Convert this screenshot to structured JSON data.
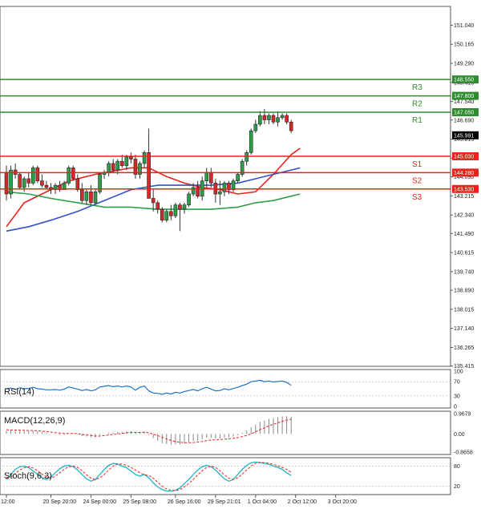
{
  "chart_data": {
    "type": "candlestick",
    "y_axis": {
      "range": [
        135.4,
        151.9
      ],
      "ticks": [
        "151.040",
        "150.165",
        "149.290",
        "148.415",
        "147.540",
        "146.690",
        "145.815",
        "144.940",
        "144.090",
        "143.215",
        "142.340",
        "141.490",
        "140.615",
        "139.740",
        "138.890",
        "138.015",
        "137.140",
        "136.265",
        "135.415"
      ]
    },
    "x_ticks": [
      {
        "label": "12:00",
        "index": 0
      },
      {
        "label": "20 Sep 20:00",
        "index": 10
      },
      {
        "label": "24 Sep 00:00",
        "index": 19
      },
      {
        "label": "25 Sep 08:00",
        "index": 28
      },
      {
        "label": "26 Sep 16:00",
        "index": 38
      },
      {
        "label": "29 Sep 21:01",
        "index": 47
      },
      {
        "label": "1 Oct 04:00",
        "index": 56
      },
      {
        "label": "2 Oct 12:00",
        "index": 65
      },
      {
        "label": "3 Oct 20:00",
        "index": 74
      }
    ],
    "candles": [
      [
        144.3,
        144.6,
        143.0,
        143.3
      ],
      [
        143.3,
        144.6,
        143.1,
        144.4
      ],
      [
        144.4,
        144.7,
        144.0,
        144.2
      ],
      [
        144.2,
        144.3,
        143.5,
        143.6
      ],
      [
        143.6,
        144.1,
        143.4,
        144.0
      ],
      [
        144.0,
        144.3,
        143.6,
        143.8
      ],
      [
        143.8,
        144.6,
        143.7,
        144.5
      ],
      [
        144.5,
        144.6,
        143.8,
        143.9
      ],
      [
        143.9,
        144.2,
        143.6,
        143.7
      ],
      [
        143.7,
        143.9,
        143.5,
        143.6
      ],
      [
        143.6,
        143.8,
        143.3,
        143.5
      ],
      [
        143.5,
        143.8,
        143.3,
        143.7
      ],
      [
        143.7,
        143.9,
        143.4,
        143.5
      ],
      [
        143.5,
        143.9,
        143.5,
        143.8
      ],
      [
        143.8,
        144.6,
        143.7,
        144.5
      ],
      [
        144.5,
        144.6,
        143.9,
        144.0
      ],
      [
        144.0,
        144.2,
        143.4,
        143.5
      ],
      [
        143.5,
        143.8,
        142.9,
        143.0
      ],
      [
        143.0,
        143.5,
        142.8,
        143.4
      ],
      [
        143.4,
        143.7,
        142.8,
        142.9
      ],
      [
        142.9,
        143.5,
        142.8,
        143.4
      ],
      [
        143.4,
        144.3,
        143.3,
        144.2
      ],
      [
        144.2,
        144.4,
        144.0,
        144.3
      ],
      [
        144.3,
        144.8,
        144.1,
        144.7
      ],
      [
        144.7,
        144.9,
        144.3,
        144.4
      ],
      [
        144.4,
        144.9,
        144.2,
        144.8
      ],
      [
        144.8,
        145.1,
        144.5,
        144.6
      ],
      [
        144.6,
        145.1,
        144.4,
        145.0
      ],
      [
        145.0,
        145.2,
        144.7,
        144.9
      ],
      [
        144.9,
        145.1,
        144.0,
        144.2
      ],
      [
        144.2,
        144.8,
        144.0,
        144.7
      ],
      [
        144.7,
        145.3,
        144.5,
        145.2
      ],
      [
        145.2,
        146.3,
        144.2,
        143.1
      ],
      [
        143.1,
        143.5,
        142.5,
        142.9
      ],
      [
        142.9,
        143.0,
        142.4,
        142.6
      ],
      [
        142.6,
        142.7,
        142.0,
        142.1
      ],
      [
        142.1,
        142.6,
        142.0,
        142.5
      ],
      [
        142.5,
        142.8,
        142.1,
        142.3
      ],
      [
        142.3,
        142.9,
        142.2,
        142.8
      ],
      [
        142.8,
        142.9,
        141.6,
        142.6
      ],
      [
        142.6,
        142.9,
        142.4,
        142.8
      ],
      [
        142.8,
        143.4,
        142.7,
        143.3
      ],
      [
        143.3,
        143.8,
        143.2,
        143.6
      ],
      [
        143.6,
        143.9,
        143.1,
        143.2
      ],
      [
        143.2,
        144.1,
        143.0,
        143.9
      ],
      [
        143.9,
        144.5,
        143.6,
        144.3
      ],
      [
        144.3,
        144.5,
        143.6,
        143.8
      ],
      [
        143.8,
        144.0,
        142.9,
        143.3
      ],
      [
        143.3,
        143.9,
        142.8,
        143.4
      ],
      [
        143.4,
        143.9,
        143.2,
        143.8
      ],
      [
        143.8,
        143.9,
        143.3,
        143.5
      ],
      [
        143.5,
        144.0,
        143.4,
        143.9
      ],
      [
        143.9,
        144.3,
        143.8,
        144.2
      ],
      [
        144.2,
        144.9,
        144.1,
        144.8
      ],
      [
        144.8,
        145.3,
        144.6,
        145.2
      ],
      [
        145.2,
        146.3,
        145.1,
        146.2
      ],
      [
        146.2,
        146.7,
        146.1,
        146.5
      ],
      [
        146.5,
        147.1,
        146.4,
        146.9
      ],
      [
        146.9,
        147.2,
        146.5,
        146.7
      ],
      [
        146.7,
        147.0,
        146.5,
        146.9
      ],
      [
        146.9,
        147.0,
        146.5,
        146.6
      ],
      [
        146.6,
        147.1,
        146.4,
        146.8
      ],
      [
        146.8,
        147.0,
        146.7,
        146.9
      ],
      [
        146.9,
        147.0,
        146.5,
        146.6
      ],
      [
        146.6,
        146.7,
        146.1,
        146.2
      ]
    ],
    "moving_averages": [
      {
        "color": "#e8231b",
        "points": [
          [
            0,
            141.8
          ],
          [
            4,
            142.9
          ],
          [
            8,
            143.3
          ],
          [
            14,
            143.9
          ],
          [
            20,
            144.2
          ],
          [
            28,
            144.5
          ],
          [
            32,
            144.5
          ],
          [
            36,
            144.1
          ],
          [
            40,
            143.8
          ],
          [
            44,
            143.6
          ],
          [
            48,
            143.5
          ],
          [
            52,
            143.3
          ],
          [
            56,
            143.4
          ],
          [
            60,
            144.2
          ],
          [
            64,
            145.1
          ],
          [
            66,
            145.4
          ]
        ]
      },
      {
        "color": "#3154c8",
        "points": [
          [
            0,
            141.6
          ],
          [
            5,
            141.8
          ],
          [
            10,
            142.1
          ],
          [
            16,
            142.5
          ],
          [
            22,
            143.0
          ],
          [
            28,
            143.5
          ],
          [
            34,
            143.7
          ],
          [
            40,
            143.7
          ],
          [
            46,
            143.7
          ],
          [
            52,
            143.8
          ],
          [
            56,
            144.0
          ],
          [
            60,
            144.2
          ],
          [
            64,
            144.4
          ],
          [
            66,
            144.5
          ]
        ]
      },
      {
        "color": "#2e9e4a",
        "points": [
          [
            0,
            143.4
          ],
          [
            5,
            143.3
          ],
          [
            10,
            143.1
          ],
          [
            16,
            142.9
          ],
          [
            22,
            142.7
          ],
          [
            28,
            142.7
          ],
          [
            34,
            142.6
          ],
          [
            40,
            142.6
          ],
          [
            46,
            142.6
          ],
          [
            52,
            142.7
          ],
          [
            56,
            142.9
          ],
          [
            60,
            143.0
          ],
          [
            64,
            143.2
          ],
          [
            66,
            143.3
          ]
        ]
      }
    ],
    "levels": [
      {
        "name": "R3",
        "value": "148.550",
        "v": 148.55,
        "color": "#2e8b2e"
      },
      {
        "name": "R2",
        "value": "147.800",
        "v": 147.8,
        "color": "#2e8b2e"
      },
      {
        "name": "R1",
        "value": "147.050",
        "v": 147.05,
        "color": "#2e8b2e"
      },
      {
        "name": "S1",
        "value": "145.030",
        "v": 145.03,
        "color": "#e8231b"
      },
      {
        "name": "S2",
        "value": "144.280",
        "v": 144.28,
        "color": "#e8231b"
      },
      {
        "name": "S3",
        "value": "143.530",
        "v": 143.53,
        "color": "#e8231b"
      }
    ],
    "current_price": {
      "value": "145.991",
      "v": 145.991
    },
    "colors": {
      "bull": "#2e9e4a",
      "bear": "#d42a2a",
      "support": "#e8231b",
      "resistance": "#2e8b2e"
    },
    "indicators": {
      "rsi": {
        "title": "RSI(14)",
        "ticks": [
          "100",
          "70",
          "30",
          "0"
        ],
        "range": [
          0,
          100
        ],
        "values": [
          50,
          52,
          48,
          53,
          50,
          51,
          54,
          50,
          49,
          47,
          47,
          48,
          46,
          49,
          55,
          52,
          49,
          45,
          48,
          44,
          47,
          55,
          57,
          59,
          56,
          58,
          55,
          58,
          55,
          46,
          54,
          58,
          44,
          38,
          37,
          34,
          38,
          35,
          40,
          38,
          42,
          45,
          48,
          44,
          50,
          54,
          49,
          44,
          45,
          50,
          47,
          51,
          54,
          59,
          63,
          70,
          72,
          74,
          70,
          72,
          69,
          71,
          72,
          68,
          60
        ],
        "color": "#1e74c9"
      },
      "macd": {
        "title": "MACD(12,26,9)",
        "ticks": [
          "0.9679",
          "0.00",
          "-0.8658"
        ],
        "range": [
          -0.8658,
          0.9679
        ],
        "histogram": [
          0.15,
          0.18,
          0.2,
          0.15,
          0.14,
          0.12,
          0.16,
          0.12,
          0.08,
          0.05,
          0.02,
          -0.02,
          -0.05,
          -0.04,
          0.02,
          0.02,
          -0.03,
          -0.1,
          -0.12,
          -0.16,
          -0.15,
          -0.05,
          0.0,
          0.06,
          0.07,
          0.1,
          0.1,
          0.13,
          0.13,
          0.05,
          0.08,
          0.12,
          -0.05,
          -0.2,
          -0.32,
          -0.45,
          -0.48,
          -0.52,
          -0.5,
          -0.5,
          -0.46,
          -0.4,
          -0.34,
          -0.32,
          -0.25,
          -0.18,
          -0.18,
          -0.22,
          -0.22,
          -0.18,
          -0.17,
          -0.12,
          -0.06,
          0.05,
          0.16,
          0.32,
          0.45,
          0.58,
          0.65,
          0.72,
          0.75,
          0.8,
          0.84,
          0.85,
          0.82
        ],
        "signal": [
          0.2,
          0.19,
          0.19,
          0.18,
          0.17,
          0.16,
          0.16,
          0.15,
          0.13,
          0.11,
          0.09,
          0.06,
          0.04,
          0.02,
          0.02,
          0.02,
          0.01,
          -0.02,
          -0.05,
          -0.08,
          -0.1,
          -0.1,
          -0.08,
          -0.05,
          -0.03,
          0.0,
          0.02,
          0.05,
          0.07,
          0.07,
          0.07,
          0.08,
          0.05,
          -0.01,
          -0.08,
          -0.16,
          -0.24,
          -0.31,
          -0.36,
          -0.4,
          -0.42,
          -0.42,
          -0.41,
          -0.39,
          -0.36,
          -0.32,
          -0.29,
          -0.28,
          -0.27,
          -0.25,
          -0.23,
          -0.21,
          -0.18,
          -0.13,
          -0.07,
          0.01,
          0.1,
          0.2,
          0.29,
          0.38,
          0.46,
          0.53,
          0.6,
          0.66,
          0.7
        ],
        "hist_color": "#888888",
        "signal_color": "#e8231b"
      },
      "stoch": {
        "title": "Stoch(9,6,3)",
        "ticks": [
          "80",
          "20"
        ],
        "range": [
          0,
          100
        ],
        "k": [
          40,
          55,
          70,
          78,
          80,
          75,
          65,
          55,
          45,
          40,
          48,
          60,
          72,
          80,
          82,
          78,
          68,
          55,
          42,
          35,
          40,
          55,
          70,
          82,
          88,
          86,
          80,
          75,
          65,
          55,
          50,
          55,
          45,
          30,
          18,
          10,
          6,
          5,
          8,
          15,
          28,
          40,
          55,
          68,
          78,
          82,
          78,
          68,
          55,
          42,
          35,
          40,
          55,
          70,
          82,
          90,
          92,
          90,
          88,
          85,
          80,
          76,
          70,
          60,
          52
        ],
        "d": [
          45,
          48,
          58,
          68,
          75,
          78,
          74,
          66,
          56,
          48,
          44,
          50,
          60,
          70,
          78,
          80,
          76,
          66,
          54,
          44,
          40,
          45,
          55,
          68,
          80,
          86,
          86,
          82,
          76,
          68,
          60,
          54,
          52,
          44,
          32,
          20,
          12,
          8,
          7,
          10,
          18,
          28,
          40,
          54,
          66,
          76,
          80,
          76,
          66,
          54,
          44,
          40,
          45,
          56,
          68,
          80,
          88,
          91,
          90,
          88,
          85,
          81,
          76,
          70,
          62
        ],
        "k_color": "#1eb4c8",
        "d_color": "#e8231b"
      }
    }
  }
}
